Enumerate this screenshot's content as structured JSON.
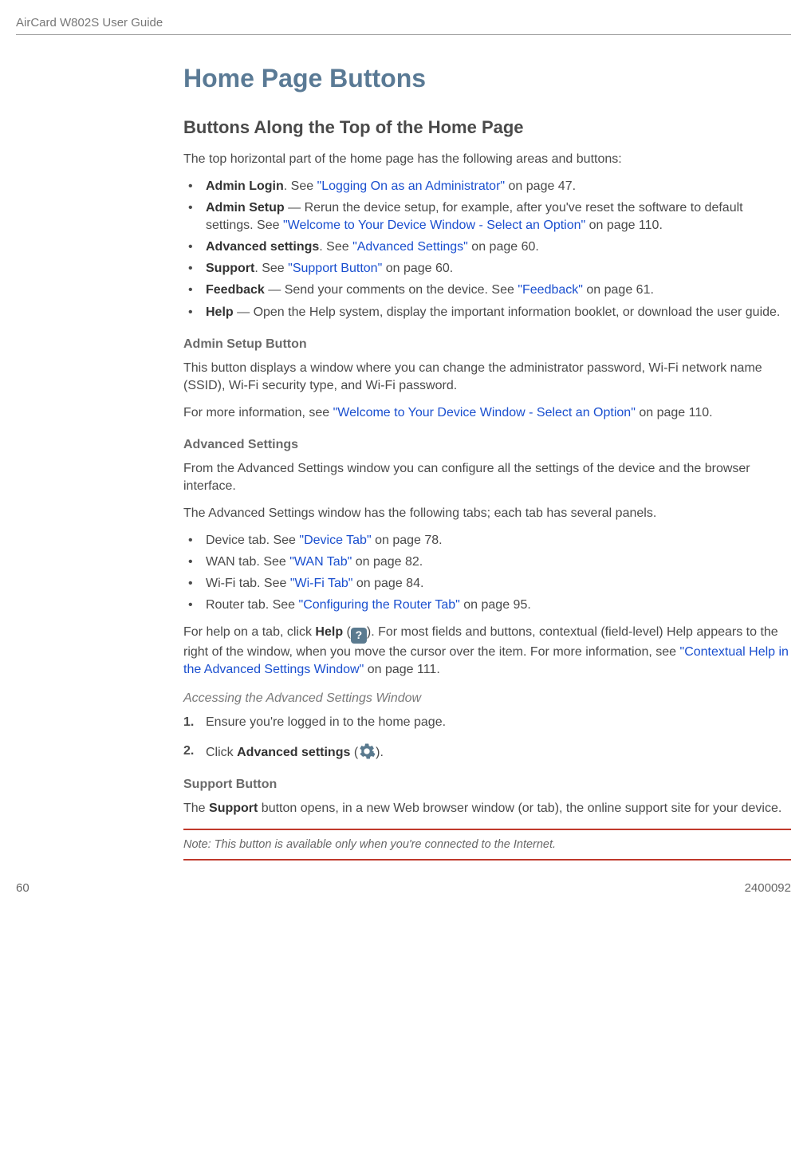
{
  "header": {
    "doc_title": "AirCard W802S User Guide"
  },
  "footer": {
    "page_number": "60",
    "doc_number": "2400092"
  },
  "h1": "Home Page Buttons",
  "h2": "Buttons Along the Top of the Home Page",
  "intro": "The top horizontal part of the home page has the following areas and buttons:",
  "topButtons": [
    {
      "label": "Admin Login",
      "after": ". See ",
      "link": "\"Logging On as an Administrator\"",
      "tail": " on page 47."
    },
    {
      "label": "Admin Setup",
      "after": " — Rerun the device setup, for example, after you've reset the software to default settings. See ",
      "link": "\"Welcome to Your Device Window - Select an Option\"",
      "tail": " on page 110."
    },
    {
      "label": "Advanced settings",
      "after": ". See ",
      "link": "\"Advanced Settings\"",
      "tail": " on page 60."
    },
    {
      "label": "Support",
      "after": ". See ",
      "link": "\"Support Button\"",
      "tail": " on page 60."
    },
    {
      "label": "Feedback",
      "after": " — Send your comments on the device. See ",
      "link": "\"Feedback\"",
      "tail": " on page 61."
    },
    {
      "label": "Help",
      "after": " — Open the Help system, display the important information booklet, or download the user guide.",
      "link": "",
      "tail": ""
    }
  ],
  "adminSetup": {
    "heading": "Admin Setup Button",
    "p1": "This button displays a window where you can change the administrator password, Wi-Fi network name (SSID), Wi-Fi security type, and Wi-Fi password.",
    "p2_pre": "For more information, see ",
    "p2_link": "\"Welcome to Your Device Window - Select an Option\"",
    "p2_tail": " on page 110."
  },
  "advanced": {
    "heading": "Advanced Settings",
    "p1": "From the Advanced Settings window you can configure all the settings of the device and the browser interface.",
    "p2": "The Advanced Settings window has the following tabs; each tab has several panels.",
    "tabs": [
      {
        "pre": "Device tab. See ",
        "link": "\"Device Tab\"",
        "tail": " on page 78."
      },
      {
        "pre": "WAN tab. See ",
        "link": "\"WAN Tab\"",
        "tail": " on page 82."
      },
      {
        "pre": "Wi-Fi tab. See ",
        "link": "\"Wi-Fi Tab\"",
        "tail": " on page 84."
      },
      {
        "pre": "Router tab. See ",
        "link": "\"Configuring the Router Tab\"",
        "tail": " on page 95."
      }
    ],
    "help_pre": "For help on a tab, click ",
    "help_bold": "Help",
    "help_mid1": " (",
    "help_mid2": "). For most fields and buttons, contextual (field-level) Help appears to the right of the window, when you move the cursor over the item. For more information, see ",
    "help_link": "\"Contextual Help in the Advanced Settings Window\"",
    "help_tail": " on page 111."
  },
  "accessing": {
    "heading": "Accessing the Advanced Settings Window",
    "step1": "Ensure you're logged in to the home page.",
    "step2_pre": "Click ",
    "step2_bold": "Advanced settings",
    "step2_mid": " (",
    "step2_tail": ")."
  },
  "support": {
    "heading": "Support Button",
    "p_pre": "The ",
    "p_bold": "Support",
    "p_tail": " button opens, in a new Web browser window (or tab), the online support site for your device."
  },
  "note": {
    "text": "Note:  This button is available only when you're connected to the Internet."
  }
}
